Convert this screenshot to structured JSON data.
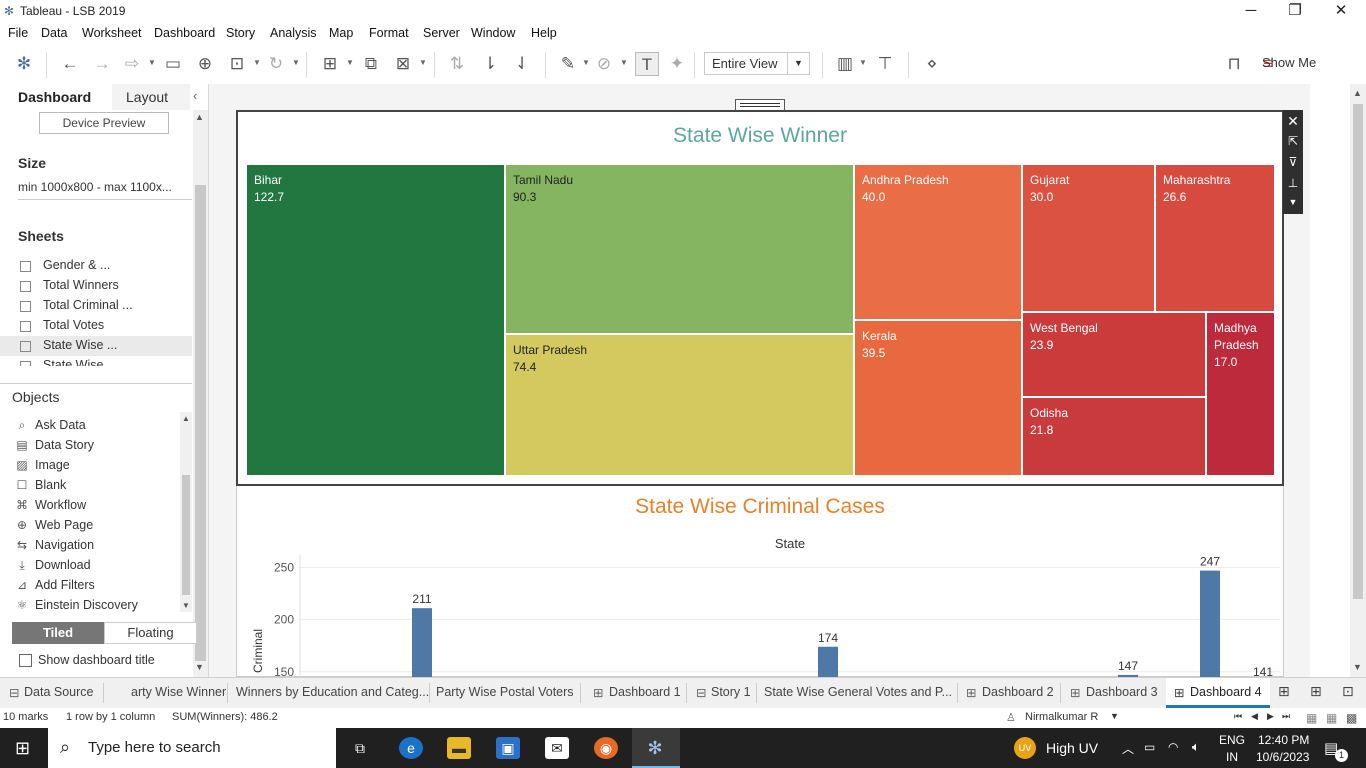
{
  "window": {
    "title": "Tableau - LSB 2019",
    "minimize": "─",
    "restore": "❐",
    "close": "✕"
  },
  "menu": [
    "File",
    "Data",
    "Worksheet",
    "Dashboard",
    "Story",
    "Analysis",
    "Map",
    "Format",
    "Server",
    "Window",
    "Help"
  ],
  "toolbar": {
    "view_mode": "Entire View",
    "show_me": "Show Me"
  },
  "left_pane": {
    "tabs": [
      "Dashboard",
      "Layout"
    ],
    "device_preview": "Device Preview",
    "size_header": "Size",
    "size_value": "min 1000x800 - max 1100x...",
    "sheets_header": "Sheets",
    "sheets": [
      "Gender & ...",
      "Total Winners",
      "Total Criminal ...",
      "Total Votes",
      "State Wise ...",
      "State Wise ..."
    ],
    "objects_header": "Objects",
    "objects": [
      {
        "label": "Ask Data",
        "icon": "ask-data-icon"
      },
      {
        "label": "Data Story",
        "icon": "data-story-icon"
      },
      {
        "label": "Image",
        "icon": "image-icon"
      },
      {
        "label": "Blank",
        "icon": "blank-icon"
      },
      {
        "label": "Workflow",
        "icon": "workflow-icon"
      },
      {
        "label": "Web Page",
        "icon": "web-page-icon"
      },
      {
        "label": "Navigation",
        "icon": "navigation-icon"
      },
      {
        "label": "Download",
        "icon": "download-icon"
      },
      {
        "label": "Add Filters",
        "icon": "add-filters-icon"
      },
      {
        "label": "Einstein Discovery",
        "icon": "einstein-discovery-icon"
      }
    ],
    "tiled": "Tiled",
    "floating": "Floating",
    "show_title": "Show dashboard title"
  },
  "treemap": {
    "title": "State Wise Winner",
    "cells": [
      {
        "state": "Bihar",
        "value": "122.7",
        "color": "#22763f",
        "text": "#ffffff"
      },
      {
        "state": "Tamil Nadu",
        "value": "90.3",
        "color": "#85b560",
        "text": "#222222"
      },
      {
        "state": "Uttar Pradesh",
        "value": "74.4",
        "color": "#d3c95e",
        "text": "#222222"
      },
      {
        "state": "Andhra Pradesh",
        "value": "40.0",
        "color": "#e96d45",
        "text": "#ffffff"
      },
      {
        "state": "Kerala",
        "value": "39.5",
        "color": "#e8693f",
        "text": "#ffffff"
      },
      {
        "state": "Gujarat",
        "value": "30.0",
        "color": "#dc5240",
        "text": "#ffffff"
      },
      {
        "state": "Maharashtra",
        "value": "26.6",
        "color": "#d74a40",
        "text": "#ffffff"
      },
      {
        "state": "West Bengal",
        "value": "23.9",
        "color": "#cb3b3c",
        "text": "#ffffff"
      },
      {
        "state": "Odisha",
        "value": "21.8",
        "color": "#c83a3c",
        "text": "#ffffff"
      },
      {
        "state": "Madhya Pradesh",
        "value": "17.0",
        "color": "#bd2a3c",
        "text": "#ffffff"
      }
    ]
  },
  "chart_data": {
    "type": "bar",
    "title": "State Wise Criminal Cases",
    "xlabel": "State",
    "ylabel": "Criminal",
    "y_ticks": [
      "250",
      "200",
      "150"
    ],
    "ylim_visible": [
      145,
      262
    ],
    "series": [
      {
        "values": [
          211,
          174,
          147,
          247,
          141
        ]
      }
    ],
    "bar_color": "#4e79a7"
  },
  "sheet_tabs": [
    "Data Source",
    "arty Wise Winner",
    "Winners by Education and Categ...",
    "Party Wise Postal Voters",
    "Dashboard 1",
    "Story 1",
    "State Wise General Votes and P...",
    "Dashboard 2",
    "Dashboard 3",
    "Dashboard 4"
  ],
  "status": {
    "marks": "10 marks",
    "rows": "1 row by 1 column",
    "sum": "SUM(Winners): 486.2",
    "user": "Nirmalkumar R"
  },
  "taskbar": {
    "search": "Type here to search",
    "weather": "High UV",
    "lang1": "ENG",
    "lang2": "IN",
    "time": "12:40 PM",
    "date": "10/6/2023",
    "uv_badge": "UV",
    "notif_count": "1"
  }
}
